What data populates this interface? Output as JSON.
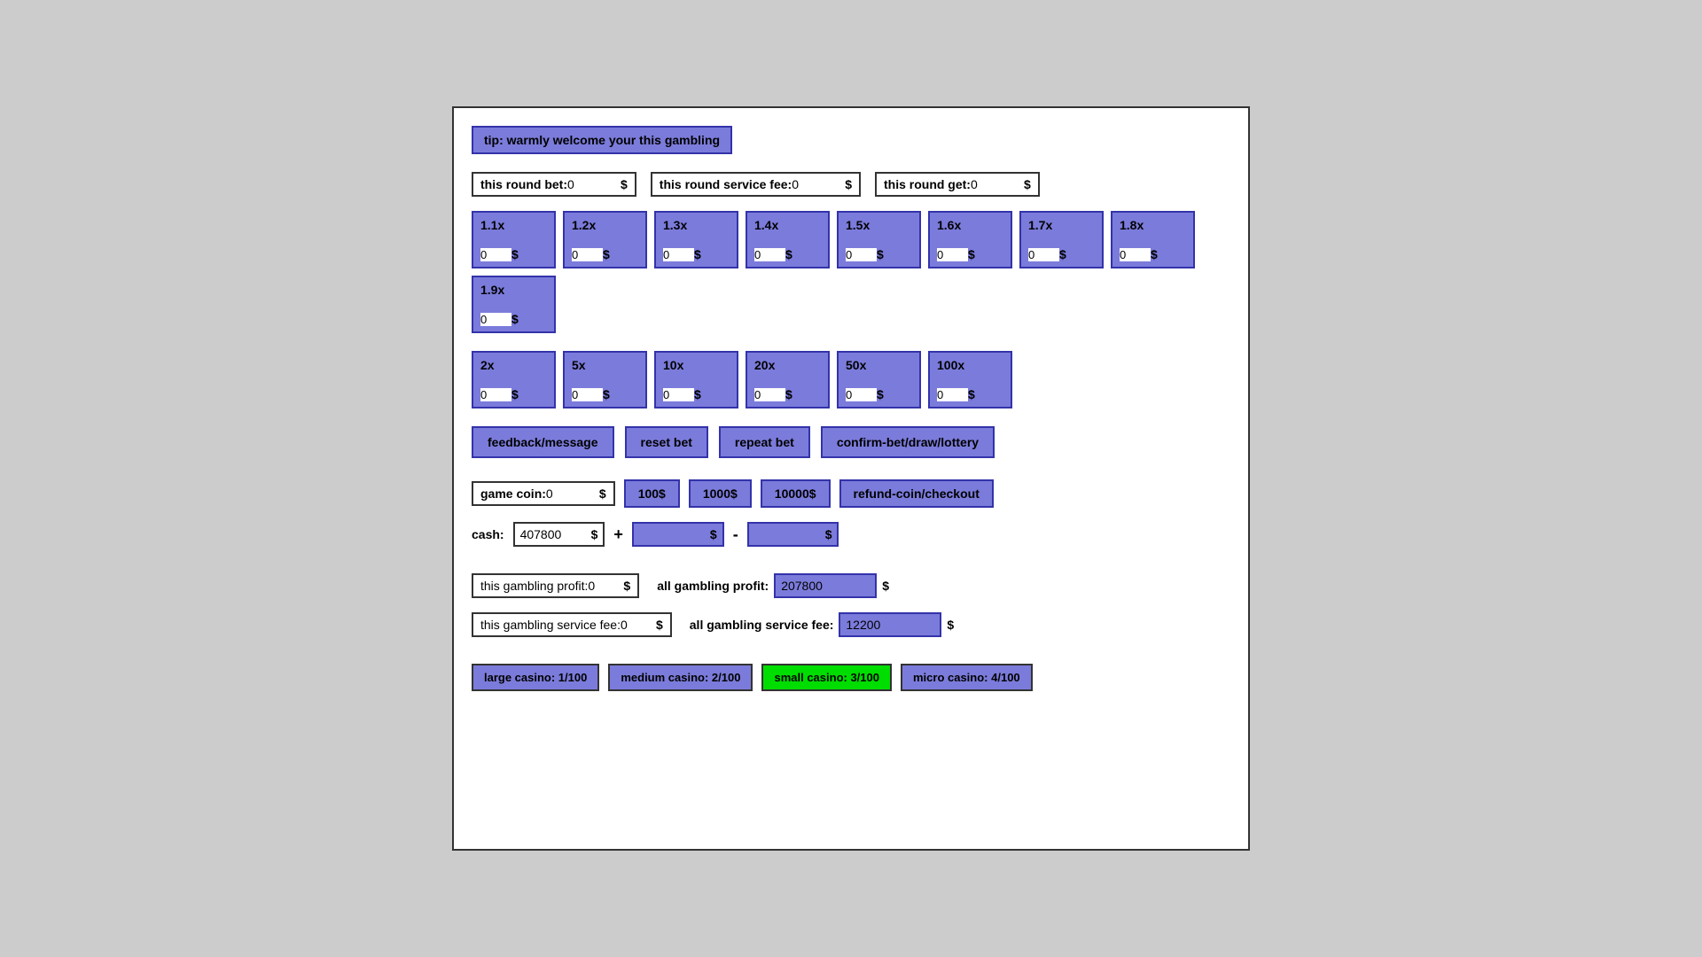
{
  "tip": {
    "text": "tip: warmly welcome your this gambling"
  },
  "round_bet": {
    "label": "this round bet:",
    "value": "0",
    "dollar": "$"
  },
  "round_fee": {
    "label": "this round service fee:",
    "value": "0",
    "dollar": "$"
  },
  "round_get": {
    "label": "this round get:",
    "value": "0",
    "dollar": "$"
  },
  "multipliers_row1": [
    {
      "label": "1.1x",
      "value": "0"
    },
    {
      "label": "1.2x",
      "value": "0"
    },
    {
      "label": "1.3x",
      "value": "0"
    },
    {
      "label": "1.4x",
      "value": "0"
    },
    {
      "label": "1.5x",
      "value": "0"
    },
    {
      "label": "1.6x",
      "value": "0"
    },
    {
      "label": "1.7x",
      "value": "0"
    },
    {
      "label": "1.8x",
      "value": "0"
    },
    {
      "label": "1.9x",
      "value": "0"
    }
  ],
  "multipliers_row2": [
    {
      "label": "2x",
      "value": "0"
    },
    {
      "label": "5x",
      "value": "0"
    },
    {
      "label": "10x",
      "value": "0"
    },
    {
      "label": "20x",
      "value": "0"
    },
    {
      "label": "50x",
      "value": "0"
    },
    {
      "label": "100x",
      "value": "0"
    }
  ],
  "actions": {
    "feedback": "feedback/message",
    "reset": "reset bet",
    "repeat": "repeat bet",
    "confirm": "confirm-bet/draw/lottery"
  },
  "game_coin": {
    "label": "game coin:",
    "value": "0",
    "dollar": "$",
    "btn100": "100$",
    "btn1000": "1000$",
    "btn10000": "10000$",
    "refund": "refund-coin/checkout"
  },
  "cash": {
    "label": "cash:",
    "value": "407800",
    "dollar": "$",
    "plus_sign": "+",
    "minus_sign": "-",
    "plus_value": "",
    "minus_value": ""
  },
  "this_profit": {
    "label": "this gambling profit:",
    "value": "0",
    "dollar": "$"
  },
  "all_profit": {
    "label": "all gambling profit:",
    "value": "207800",
    "dollar": "$"
  },
  "this_fee": {
    "label": "this gambling service fee:",
    "value": "0",
    "dollar": "$"
  },
  "all_fee": {
    "label": "all gambling service fee:",
    "value": "12200",
    "dollar": "$"
  },
  "casinos": {
    "large": "large casino: 1/100",
    "medium": "medium casino: 2/100",
    "small": "small casino: 3/100",
    "micro": "micro casino: 4/100"
  }
}
